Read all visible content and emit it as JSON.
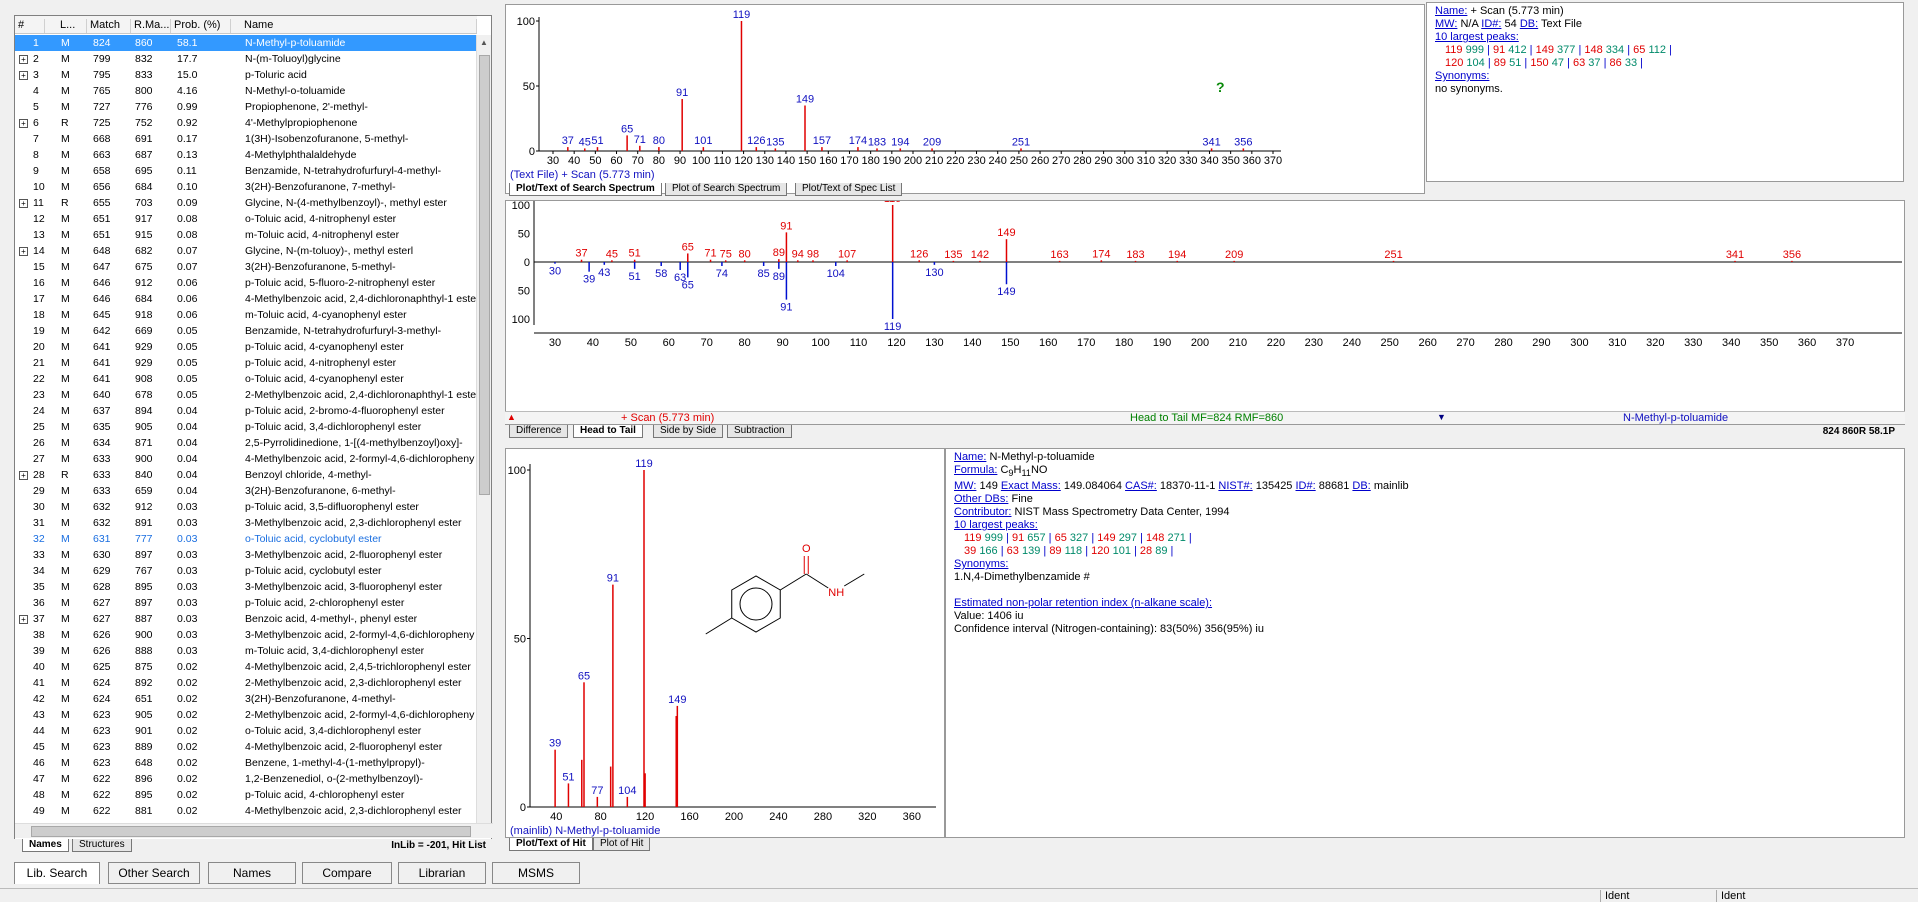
{
  "hitlist": {
    "columns": [
      "#",
      "L...",
      "Match",
      "R.Ma...",
      "Prob. (%)",
      "Name"
    ],
    "rows": [
      [
        "1",
        "M",
        "824",
        "860",
        "58.1",
        "N-Methyl-p-toluamide"
      ],
      [
        "2",
        "M",
        "799",
        "832",
        "17.7",
        "N-(m-Toluoyl)glycine"
      ],
      [
        "3",
        "M",
        "795",
        "833",
        "15.0",
        "p-Toluric acid"
      ],
      [
        "4",
        "M",
        "765",
        "800",
        "4.16",
        "N-Methyl-o-toluamide"
      ],
      [
        "5",
        "M",
        "727",
        "776",
        "0.99",
        "Propiophenone, 2'-methyl-"
      ],
      [
        "6",
        "R",
        "725",
        "752",
        "0.92",
        "4'-Methylpropiophenone"
      ],
      [
        "7",
        "M",
        "668",
        "691",
        "0.17",
        "1(3H)-Isobenzofuranone, 5-methyl-"
      ],
      [
        "8",
        "M",
        "663",
        "687",
        "0.13",
        "4-Methylphthalaldehyde"
      ],
      [
        "9",
        "M",
        "658",
        "695",
        "0.11",
        "Benzamide, N-tetrahydrofurfuryl-4-methyl-"
      ],
      [
        "10",
        "M",
        "656",
        "684",
        "0.10",
        "3(2H)-Benzofuranone, 7-methyl-"
      ],
      [
        "11",
        "R",
        "655",
        "703",
        "0.09",
        "Glycine, N-(4-methylbenzoyl)-, methyl ester"
      ],
      [
        "12",
        "M",
        "651",
        "917",
        "0.08",
        "o-Toluic acid, 4-nitrophenyl ester"
      ],
      [
        "13",
        "M",
        "651",
        "915",
        "0.08",
        "m-Toluic acid, 4-nitrophenyl ester"
      ],
      [
        "14",
        "M",
        "648",
        "682",
        "0.07",
        "Glycine, N-(m-toluoy)-, methyl esterl"
      ],
      [
        "15",
        "M",
        "647",
        "675",
        "0.07",
        "3(2H)-Benzofuranone, 5-methyl-"
      ],
      [
        "16",
        "M",
        "646",
        "912",
        "0.06",
        "p-Toluic acid, 5-fluoro-2-nitrophenyl ester"
      ],
      [
        "17",
        "M",
        "646",
        "684",
        "0.06",
        "4-Methylbenzoic acid, 2,4-dichloronaphthyl-1 este"
      ],
      [
        "18",
        "M",
        "645",
        "918",
        "0.06",
        "m-Toluic acid, 4-cyanophenyl ester"
      ],
      [
        "19",
        "M",
        "642",
        "669",
        "0.05",
        "Benzamide, N-tetrahydrofurfuryl-3-methyl-"
      ],
      [
        "20",
        "M",
        "641",
        "929",
        "0.05",
        "p-Toluic acid, 4-cyanophenyl ester"
      ],
      [
        "21",
        "M",
        "641",
        "929",
        "0.05",
        "p-Toluic acid, 4-nitrophenyl ester"
      ],
      [
        "22",
        "M",
        "641",
        "908",
        "0.05",
        "o-Toluic acid, 4-cyanophenyl ester"
      ],
      [
        "23",
        "M",
        "640",
        "678",
        "0.05",
        "2-Methylbenzoic acid, 2,4-dichloronaphthyl-1 este"
      ],
      [
        "24",
        "M",
        "637",
        "894",
        "0.04",
        "p-Toluic acid, 2-bromo-4-fluorophenyl ester"
      ],
      [
        "25",
        "M",
        "635",
        "905",
        "0.04",
        "p-Toluic acid, 3,4-dichlorophenyl ester"
      ],
      [
        "26",
        "M",
        "634",
        "871",
        "0.04",
        "2,5-Pyrrolidinedione, 1-[(4-methylbenzoyl)oxy]-"
      ],
      [
        "27",
        "M",
        "633",
        "900",
        "0.04",
        "4-Methylbenzoic acid, 2-formyl-4,6-dichloropheny"
      ],
      [
        "28",
        "R",
        "633",
        "840",
        "0.04",
        "Benzoyl chloride, 4-methyl-"
      ],
      [
        "29",
        "M",
        "633",
        "659",
        "0.04",
        "3(2H)-Benzofuranone, 6-methyl-"
      ],
      [
        "30",
        "M",
        "632",
        "912",
        "0.03",
        "p-Toluic acid, 3,5-difluorophenyl ester"
      ],
      [
        "31",
        "M",
        "632",
        "891",
        "0.03",
        "3-Methylbenzoic acid, 2,3-dichlorophenyl ester"
      ],
      [
        "32",
        "M",
        "631",
        "777",
        "0.03",
        "o-Toluic acid, cyclobutyl ester"
      ],
      [
        "33",
        "M",
        "630",
        "897",
        "0.03",
        "3-Methylbenzoic acid, 2-fluorophenyl ester"
      ],
      [
        "34",
        "M",
        "629",
        "767",
        "0.03",
        "p-Toluic acid, cyclobutyl ester"
      ],
      [
        "35",
        "M",
        "628",
        "895",
        "0.03",
        "3-Methylbenzoic acid, 3-fluorophenyl ester"
      ],
      [
        "36",
        "M",
        "627",
        "897",
        "0.03",
        "p-Toluic acid, 2-chlorophenyl ester"
      ],
      [
        "37",
        "M",
        "627",
        "887",
        "0.03",
        "Benzoic acid, 4-methyl-, phenyl ester"
      ],
      [
        "38",
        "M",
        "626",
        "900",
        "0.03",
        "3-Methylbenzoic acid, 2-formyl-4,6-dichloropheny"
      ],
      [
        "39",
        "M",
        "626",
        "888",
        "0.03",
        "m-Toluic acid, 3,4-dichlorophenyl ester"
      ],
      [
        "40",
        "M",
        "625",
        "875",
        "0.02",
        "4-Methylbenzoic acid, 2,4,5-trichlorophenyl ester"
      ],
      [
        "41",
        "M",
        "624",
        "892",
        "0.02",
        "2-Methylbenzoic acid, 2,3-dichlorophenyl ester"
      ],
      [
        "42",
        "M",
        "624",
        "651",
        "0.02",
        "3(2H)-Benzofuranone, 4-methyl-"
      ],
      [
        "43",
        "M",
        "623",
        "905",
        "0.02",
        "2-Methylbenzoic acid, 2-formyl-4,6-dichloropheny"
      ],
      [
        "44",
        "M",
        "623",
        "901",
        "0.02",
        "o-Toluic acid, 3,4-dichlorophenyl ester"
      ],
      [
        "45",
        "M",
        "623",
        "889",
        "0.02",
        "4-Methylbenzoic acid, 2-fluorophenyl ester"
      ],
      [
        "46",
        "M",
        "623",
        "648",
        "0.02",
        "Benzene, 1-methyl-4-(1-methylpropyl)-"
      ],
      [
        "47",
        "M",
        "622",
        "896",
        "0.02",
        "1,2-Benzenediol, o-(2-methylbenzoyl)-"
      ],
      [
        "48",
        "M",
        "622",
        "895",
        "0.02",
        "p-Toluic acid, 4-chlorophenyl ester"
      ],
      [
        "49",
        "M",
        "622",
        "881",
        "0.02",
        "4-Methylbenzoic acid, 2,3-dichlorophenyl ester"
      ]
    ],
    "expandable_rows": [
      2,
      3,
      6,
      11,
      14,
      28,
      37
    ],
    "selected_row": 1,
    "highlight_row": 32,
    "tabs": [
      "Names",
      "Structures"
    ],
    "status": "InLib = -201, Hit List"
  },
  "search_spectrum": {
    "title": "(Text File) + Scan (5.773 min)",
    "x_ticks": [
      30,
      40,
      50,
      60,
      70,
      80,
      90,
      100,
      110,
      120,
      130,
      140,
      150,
      160,
      170,
      180,
      190,
      200,
      210,
      220,
      230,
      240,
      250,
      260,
      270,
      280,
      290,
      300,
      310,
      320,
      330,
      340,
      350,
      360,
      370
    ],
    "y_ticks": [
      0,
      50,
      100
    ],
    "peaks": [
      [
        37,
        3
      ],
      [
        45,
        2
      ],
      [
        51,
        3
      ],
      [
        65,
        12
      ],
      [
        71,
        4
      ],
      [
        80,
        3
      ],
      [
        91,
        40
      ],
      [
        101,
        3
      ],
      [
        119,
        100
      ],
      [
        126,
        3
      ],
      [
        135,
        2
      ],
      [
        149,
        35
      ],
      [
        157,
        3
      ],
      [
        174,
        3
      ],
      [
        183,
        2
      ],
      [
        194,
        2
      ],
      [
        209,
        2
      ],
      [
        251,
        2
      ],
      [
        341,
        2
      ],
      [
        356,
        2
      ]
    ],
    "labeled": [
      37,
      45,
      51,
      65,
      71,
      80,
      91,
      101,
      119,
      126,
      135,
      149,
      157,
      174,
      183,
      194,
      209,
      251,
      341,
      356
    ],
    "tabs": [
      "Plot/Text of Search Spectrum",
      "Plot of Search Spectrum",
      "Plot/Text of Spec List"
    ],
    "question_mark": "?"
  },
  "scan_info": {
    "name_label": "Name:",
    "name": "+ Scan (5.773 min)",
    "mw_label": "MW:",
    "mw": "N/A",
    "id_label": "ID#:",
    "id": "54",
    "db_label": "DB:",
    "db": "Text File",
    "peaks_label": "10 largest peaks:",
    "peaks_row1": [
      [
        "119",
        "999"
      ],
      [
        "91",
        "412"
      ],
      [
        "149",
        "377"
      ],
      [
        "148",
        "334"
      ],
      [
        "65",
        "112"
      ]
    ],
    "peaks_row2": [
      [
        "120",
        "104"
      ],
      [
        "89",
        "51"
      ],
      [
        "150",
        "47"
      ],
      [
        "63",
        "37"
      ],
      [
        "86",
        "33"
      ]
    ],
    "syn_label": "Synonyms:",
    "synonyms": "no synonyms."
  },
  "head_to_tail": {
    "x_ticks": [
      30,
      40,
      50,
      60,
      70,
      80,
      90,
      100,
      110,
      120,
      130,
      140,
      150,
      160,
      170,
      180,
      190,
      200,
      210,
      220,
      230,
      240,
      250,
      260,
      270,
      280,
      290,
      300,
      310,
      320,
      330,
      340,
      350,
      360,
      370
    ],
    "y_ticks_top": [
      100,
      50,
      0
    ],
    "y_ticks_bottom": [
      50,
      100
    ],
    "top_peaks": [
      [
        37,
        4
      ],
      [
        45,
        3
      ],
      [
        51,
        4
      ],
      [
        65,
        15
      ],
      [
        71,
        4
      ],
      [
        75,
        3
      ],
      [
        80,
        3
      ],
      [
        89,
        5
      ],
      [
        91,
        52
      ],
      [
        94,
        3
      ],
      [
        98,
        3
      ],
      [
        107,
        3
      ],
      [
        119,
        100
      ],
      [
        126,
        3
      ],
      [
        135,
        2
      ],
      [
        142,
        2
      ],
      [
        149,
        40
      ],
      [
        163,
        2
      ],
      [
        174,
        3
      ],
      [
        183,
        2
      ],
      [
        194,
        2
      ],
      [
        209,
        2
      ],
      [
        251,
        2
      ],
      [
        341,
        2
      ],
      [
        356,
        2
      ]
    ],
    "top_labeled": [
      37,
      45,
      51,
      65,
      71,
      75,
      80,
      89,
      91,
      94,
      98,
      107,
      119,
      126,
      135,
      142,
      149,
      163,
      174,
      183,
      194,
      209,
      251,
      341,
      356
    ],
    "bottom_peaks": [
      [
        30,
        3
      ],
      [
        39,
        17
      ],
      [
        43,
        5
      ],
      [
        51,
        12
      ],
      [
        58,
        7
      ],
      [
        63,
        14
      ],
      [
        65,
        27
      ],
      [
        74,
        7
      ],
      [
        85,
        7
      ],
      [
        89,
        12
      ],
      [
        91,
        66
      ],
      [
        104,
        7
      ],
      [
        119,
        100
      ],
      [
        130,
        5
      ],
      [
        149,
        39
      ]
    ],
    "bottom_labeled": [
      30,
      39,
      43,
      51,
      58,
      63,
      65,
      74,
      85,
      89,
      91,
      104,
      119,
      130,
      149
    ],
    "footer_left": "+ Scan (5.773 min)",
    "footer_mid": "Head to Tail MF=824 RMF=860",
    "footer_right": "N-Methyl-p-toluamide",
    "tabs": [
      "Difference",
      "Head to Tail",
      "Side by Side",
      "Subtraction"
    ],
    "status": "824 860R 58.1P"
  },
  "hit_spectrum": {
    "title": "(mainlib) N-Methyl-p-toluamide",
    "x_ticks": [
      40,
      80,
      120,
      160,
      200,
      240,
      280,
      320,
      360
    ],
    "y_ticks": [
      0,
      50,
      100
    ],
    "peaks": [
      [
        39,
        17
      ],
      [
        51,
        7
      ],
      [
        63,
        14
      ],
      [
        65,
        37
      ],
      [
        77,
        3
      ],
      [
        89,
        12
      ],
      [
        91,
        66
      ],
      [
        104,
        3
      ],
      [
        119,
        100
      ],
      [
        120,
        10
      ],
      [
        148,
        27
      ],
      [
        149,
        30
      ]
    ],
    "labeled": [
      39,
      51,
      65,
      77,
      91,
      104,
      119,
      149
    ],
    "struct_labels": [
      "O",
      "NH"
    ],
    "tabs": [
      "Plot/Text of Hit",
      "Plot of Hit"
    ]
  },
  "hit_info": {
    "name_label": "Name:",
    "name": "N-Methyl-p-toluamide",
    "formula_label": "Formula:",
    "formula_pre": "C",
    "formula_s1": "9",
    "formula_mid": "H",
    "formula_s2": "11",
    "formula_post": "NO",
    "mw_label": "MW:",
    "mw": "149",
    "exact_label": "Exact Mass:",
    "exact": "149.084064",
    "cas_label": "CAS#:",
    "cas": "18370-11-1",
    "nist_label": "NIST#:",
    "nist": "135425",
    "id_label": "ID#:",
    "id": "88681",
    "db_label": "DB:",
    "db": "mainlib",
    "other_label": "Other DBs:",
    "other": "Fine",
    "contrib_label": "Contributor:",
    "contrib": "NIST Mass Spectrometry Data Center, 1994",
    "peaks_label": "10 largest peaks:",
    "peaks_row1": [
      [
        "119",
        "999"
      ],
      [
        "91",
        "657"
      ],
      [
        "65",
        "327"
      ],
      [
        "149",
        "297"
      ],
      [
        "148",
        "271"
      ]
    ],
    "peaks_row2": [
      [
        "39",
        "166"
      ],
      [
        "63",
        "139"
      ],
      [
        "89",
        "118"
      ],
      [
        "120",
        "101"
      ],
      [
        "28",
        "89"
      ]
    ],
    "syn_label": "Synonyms:",
    "synonyms": "1.N,4-Dimethylbenzamide  #",
    "ri_label": "Estimated non-polar retention index (n-alkane scale):",
    "ri_value": "Value: 1406 iu",
    "ri_ci": "Confidence interval (Nitrogen-containing):  83(50%) 356(95%) iu"
  },
  "bottom_tabs": [
    "Lib. Search",
    "Other Search",
    "Names",
    "Compare",
    "Librarian",
    "MSMS"
  ],
  "status_bar": [
    "Ident",
    "Ident"
  ]
}
